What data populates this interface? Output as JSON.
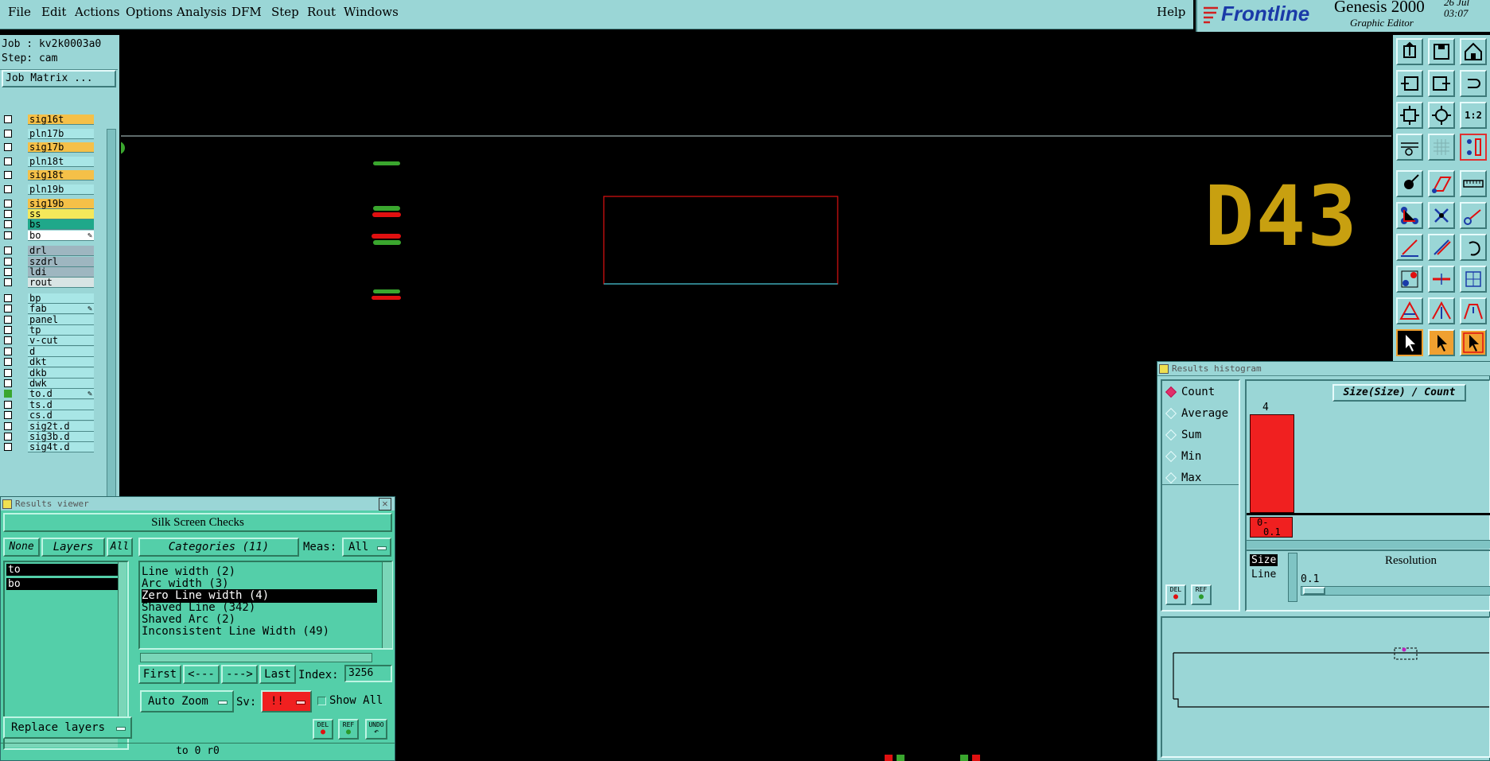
{
  "menu": {
    "items": [
      "File",
      "Edit",
      "Actions",
      "Options",
      "Analysis",
      "DFM",
      "Step",
      "Rout",
      "Windows"
    ],
    "help": "Help"
  },
  "brand": {
    "logo": "Frontline",
    "product": "Genesis 2000",
    "subtitle": "Graphic Editor",
    "date": "26 Jul",
    "time": "03:07"
  },
  "job": {
    "job_line": "Job : kv2k0003a0",
    "step_line": "Step: cam",
    "matrix_button": "Job Matrix ..."
  },
  "layers": [
    {
      "name": "sig16t",
      "color": "#f5c048",
      "checked": false,
      "edit": false
    },
    {
      "name": "pln17b",
      "color": "#a8e6e6",
      "checked": false,
      "edit": false
    },
    {
      "name": "sig17b",
      "color": "#f5c048",
      "checked": false,
      "edit": false
    },
    {
      "name": "pln18t",
      "color": "#a8e6e6",
      "checked": false,
      "edit": false
    },
    {
      "name": "sig18t",
      "color": "#f5c048",
      "checked": false,
      "edit": false
    },
    {
      "name": "pln19b",
      "color": "#a8e6e6",
      "checked": false,
      "edit": false
    },
    {
      "name": "sig19b",
      "color": "#f5c048",
      "checked": false,
      "edit": false
    },
    {
      "name": "ss",
      "color": "#f5e85a",
      "checked": false,
      "edit": false
    },
    {
      "name": "bs",
      "color": "#1fa88a",
      "checked": false,
      "edit": false
    },
    {
      "name": "bo",
      "color": "#ffffff",
      "checked": false,
      "edit": true
    },
    {
      "name": "drl",
      "color": "#9eb6c0",
      "checked": false,
      "edit": false
    },
    {
      "name": "szdrl",
      "color": "#9eb6c0",
      "checked": false,
      "edit": false
    },
    {
      "name": "ldi",
      "color": "#9eb6c0",
      "checked": false,
      "edit": false
    },
    {
      "name": "rout",
      "color": "#d8e4e4",
      "checked": false,
      "edit": false
    },
    {
      "name": "bp",
      "color": "#a8e6e6",
      "checked": false,
      "edit": false
    },
    {
      "name": "fab",
      "color": "#a8e6e6",
      "checked": false,
      "edit": true
    },
    {
      "name": "panel",
      "color": "#a8e6e6",
      "checked": false,
      "edit": false
    },
    {
      "name": "tp",
      "color": "#a8e6e6",
      "checked": false,
      "edit": false
    },
    {
      "name": "v-cut",
      "color": "#a8e6e6",
      "checked": false,
      "edit": false
    },
    {
      "name": "d",
      "color": "#a8e6e6",
      "checked": false,
      "edit": false
    },
    {
      "name": "dkt",
      "color": "#a8e6e6",
      "checked": false,
      "edit": false
    },
    {
      "name": "dkb",
      "color": "#a8e6e6",
      "checked": false,
      "edit": false
    },
    {
      "name": "dwk",
      "color": "#a8e6e6",
      "checked": false,
      "edit": false
    },
    {
      "name": "to.d",
      "color": "#a8e6e6",
      "checked": true,
      "edit": true
    },
    {
      "name": "ts.d",
      "color": "#a8e6e6",
      "checked": false,
      "edit": false
    },
    {
      "name": "cs.d",
      "color": "#a8e6e6",
      "checked": false,
      "edit": false
    },
    {
      "name": "sig2t.d",
      "color": "#a8e6e6",
      "checked": false,
      "edit": false
    },
    {
      "name": "sig3b.d",
      "color": "#a8e6e6",
      "checked": false,
      "edit": false
    },
    {
      "name": "sig4t.d",
      "color": "#a8e6e6",
      "checked": false,
      "edit": false
    }
  ],
  "canvas": {
    "label": "D43"
  },
  "results_viewer": {
    "title": "Results viewer",
    "check_name": "Silk Screen Checks",
    "none_btn": "None",
    "layers_btn": "Layers",
    "all_btn": "All",
    "categories_btn": "Categories (11)",
    "meas_label": "Meas:",
    "meas_value": "All",
    "layer_list": [
      "to",
      "bo"
    ],
    "categories": [
      {
        "label": "Line width (2)",
        "selected": false
      },
      {
        "label": "Arc width (3)",
        "selected": false
      },
      {
        "label": "Zero Line width (4)",
        "selected": true
      },
      {
        "label": "Shaved Line (342)",
        "selected": false
      },
      {
        "label": "Shaved Arc (2)",
        "selected": false
      },
      {
        "label": "Inconsistent Line Width (49)",
        "selected": false
      }
    ],
    "first_btn": "First",
    "prev_btn": "<---",
    "next_btn": "--->",
    "last_btn": "Last",
    "index_label": "Index:",
    "index_value": "3256",
    "auto_zoom": "Auto Zoom",
    "sv_label": "Sv:",
    "sv_value": "!!",
    "show_all": "Show All",
    "replace_layers": "Replace layers",
    "del": "DEL",
    "ref": "REF",
    "undo": "UNDO",
    "status": "to 0  r0"
  },
  "histogram": {
    "title": "Results histogram",
    "modes": [
      {
        "label": "Count",
        "on": true
      },
      {
        "label": "Average",
        "on": false
      },
      {
        "label": "Sum",
        "on": false
      },
      {
        "label": "Min",
        "on": false
      },
      {
        "label": "Max",
        "on": false
      }
    ],
    "chart_title": "Size(Size) / Count",
    "bar_value": "4",
    "bin_label": "0-\n0.1",
    "bin_line1": "0-",
    "bin_line2": "0.1",
    "size_label": "Size",
    "line_label": "Line",
    "resolution_label": "Resolution",
    "resolution_value": "0.1",
    "del": "DEL",
    "ref": "REF"
  }
}
